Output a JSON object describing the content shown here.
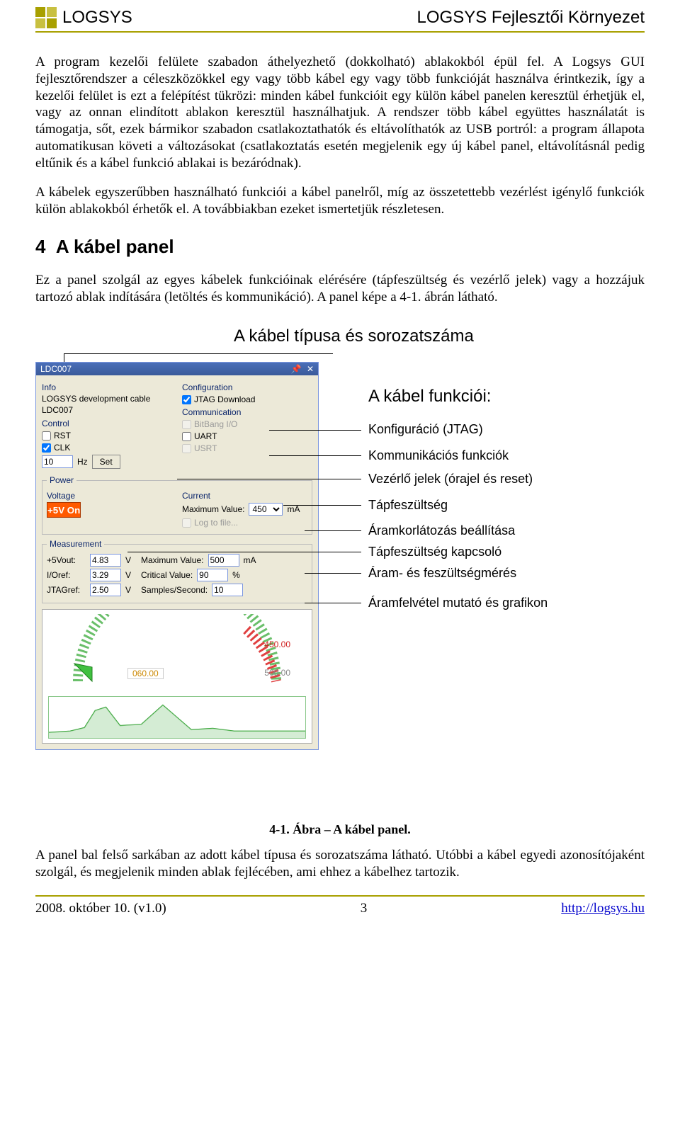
{
  "header": {
    "brand": "LOGSYS",
    "right": "LOGSYS Fejlesztői Környezet"
  },
  "para1": "A program kezelői felülete szabadon áthelyezhető (dokkolható) ablakokból épül fel. A Logsys GUI fejlesztőrendszer a céleszközökkel egy vagy több kábel egy vagy több funkcióját használva érintkezik, így a kezelői felület is ezt a felépítést tükrözi: minden kábel funkcióit egy külön kábel panelen keresztül érhetjük el, vagy az onnan elindított ablakon keresztül használhatjuk. A rendszer több kábel együttes használatát is támogatja, sőt, ezek bármikor szabadon csatlakoztathatók és eltávolíthatók az USB portról: a program állapota automatikusan követi a változásokat (csatlakoztatás esetén megjelenik egy új kábel panel, eltávolításnál pedig eltűnik és a kábel funkció ablakai is bezáródnak).",
  "para2": "A kábelek egyszerűbben használható funkciói a kábel panelről, míg az összetettebb vezérlést igénylő funkciók külön ablakokból érhetők el. A továbbiakban ezeket ismertetjük részletesen.",
  "section": {
    "num": "4",
    "title": "A kábel panel"
  },
  "para3": "Ez a panel szolgál az egyes kábelek funkcióinak elérésére (tápfeszültség és vezérlő jelek) vagy a hozzájuk tartozó ablak indítására (letöltés és kommunikáció). A panel képe a 4-1. ábrán látható.",
  "panel": {
    "title": "LDC007",
    "infoLabel": "Info",
    "infoText1": "LOGSYS development cable",
    "infoText2": "LDC007",
    "configLabel": "Configuration",
    "jtag": "JTAG Download",
    "controlLabel": "Control",
    "rst": "RST",
    "clk": "CLK",
    "clkVal": "10",
    "hz": "Hz",
    "set": "Set",
    "commLabel": "Communication",
    "bitbang": "BitBang I/O",
    "uart": "UART",
    "usrt": "USRT",
    "powerLegend": "Power",
    "voltageLabel": "Voltage",
    "on": "+5V On",
    "currentLabel": "Current",
    "maxLbl": "Maximum Value:",
    "maxVal": "450",
    "maUnit": "mA",
    "logto": "Log to file...",
    "measLegend": "Measurement",
    "m1": "+5Vout:",
    "m1v": "4.83",
    "m1u": "V",
    "max2Lbl": "Maximum Value:",
    "max2Val": "500",
    "max2u": "mA",
    "m2": "I/Oref:",
    "m2v": "3.29",
    "m2u": "V",
    "critLbl": "Critical Value:",
    "critVal": "90",
    "critU": "%",
    "m3": "JTAGref:",
    "m3v": "2.50",
    "m3u": "V",
    "spsLbl": "Samples/Second:",
    "spsVal": "10",
    "g450": "450.00",
    "g060": "060.00",
    "g500": "500.00"
  },
  "callouts": {
    "top": "A kábel típusa és sorozatszáma",
    "funcTitle": "A kábel funkciói:",
    "c1": "Konfiguráció (JTAG)",
    "c2": "Kommunikációs funkciók",
    "c3": "Vezérlő jelek (órajel és reset)",
    "c4": "Tápfeszültség",
    "c5": "Áramkorlátozás beállítása",
    "c6": "Tápfeszültség kapcsoló",
    "c7": "Áram- és feszültségmérés",
    "c8": "Áramfelvétel mutató és grafikon"
  },
  "caption": "4-1. Ábra – A kábel panel.",
  "para4": "A panel bal felső sarkában az adott kábel típusa és sorozatszáma látható. Utóbbi a kábel egyedi azonosítójaként szolgál, és megjelenik minden ablak fejlécében, ami ehhez a kábelhez tartozik.",
  "footer": {
    "left": "2008. október 10. (v1.0)",
    "center": "3",
    "right": "http://logsys.hu"
  }
}
